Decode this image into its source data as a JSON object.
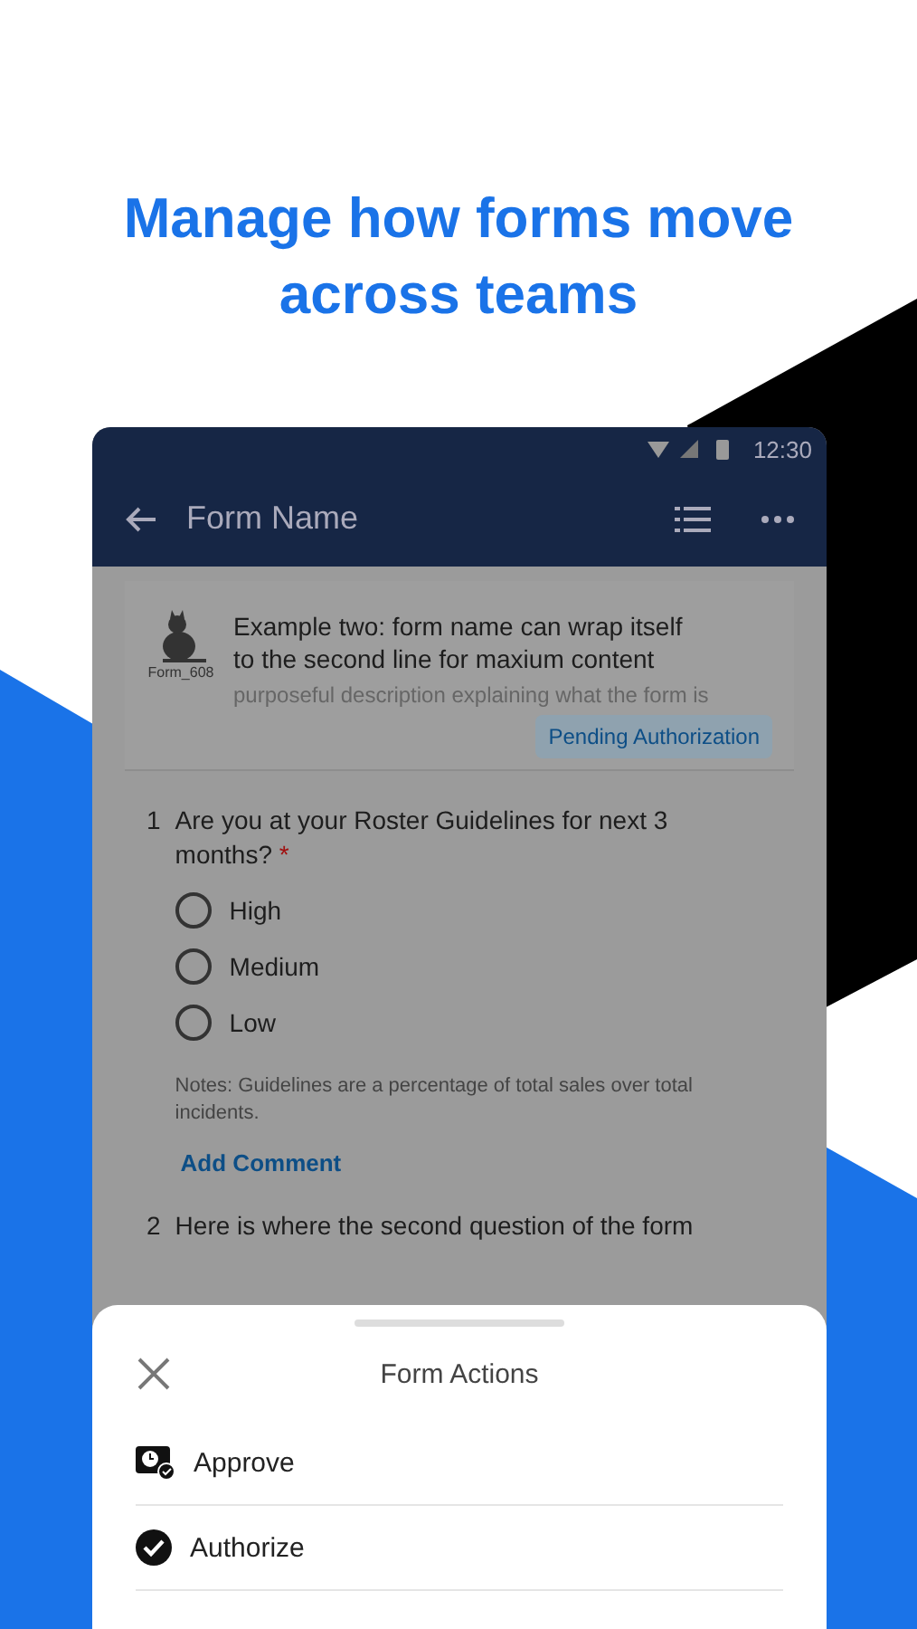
{
  "headline": "Manage how forms move across teams",
  "status_bar": {
    "time": "12:30"
  },
  "app_bar": {
    "title": "Form Name"
  },
  "form_card": {
    "thumbnail_label": "Form_608",
    "title": "Example two: form name can wrap itself to the second line for maxium content",
    "description": "purposeful description explaining what the form is",
    "status": "Pending Authorization"
  },
  "questions": [
    {
      "number": "1",
      "text": "Are you at your Roster Guidelines for next 3 months?",
      "required": true,
      "required_mark": "*",
      "options": [
        {
          "label": "High",
          "selected": false
        },
        {
          "label": "Medium",
          "selected": false
        },
        {
          "label": "Low",
          "selected": false
        }
      ],
      "notes": "Notes: Guidelines are a percentage of total sales over total incidents.",
      "link": "Add Comment"
    },
    {
      "number": "2",
      "text": "Here is where the second question of the form"
    }
  ],
  "sheet": {
    "title": "Form Actions",
    "actions": [
      {
        "kind": "approve",
        "label": "Approve"
      },
      {
        "kind": "authorize",
        "label": "Authorize"
      }
    ]
  }
}
